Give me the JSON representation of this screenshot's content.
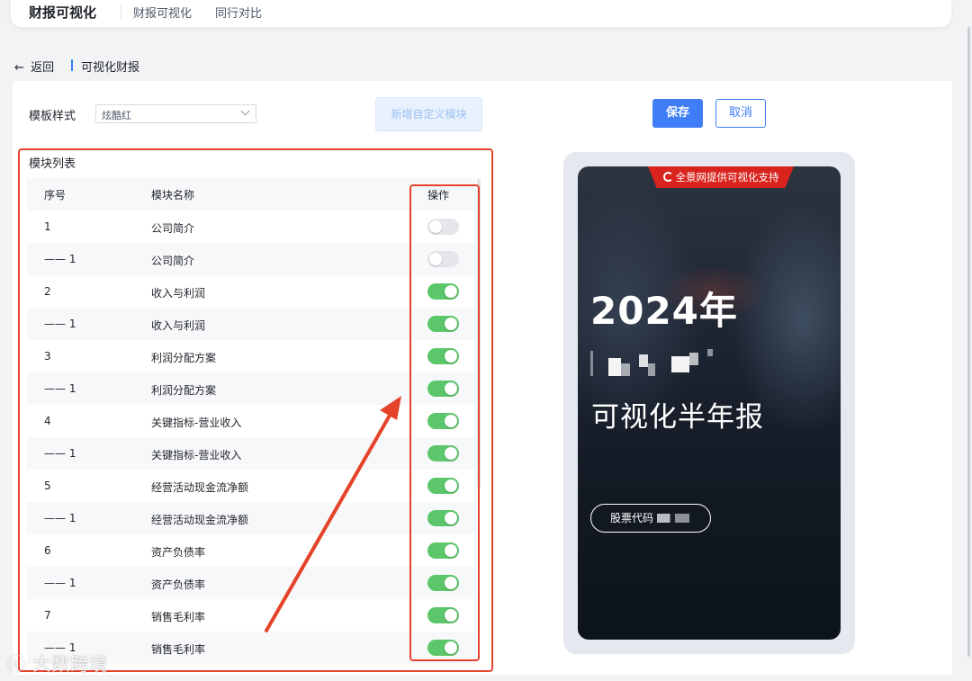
{
  "nav": {
    "brand": "财报可视化",
    "links": [
      "财报可视化",
      "同行对比"
    ]
  },
  "breadcrumb": {
    "back": "返回",
    "title": "可视化财报"
  },
  "form": {
    "template_label": "模板样式",
    "template_value": "炫酷红",
    "add_module": "新增自定义模块",
    "save": "保存",
    "cancel": "取消"
  },
  "module_list": {
    "title": "模块列表",
    "headers": {
      "index": "序号",
      "name": "模块名称",
      "action": "操作"
    },
    "rows": [
      {
        "index": "1",
        "name": "公司简介",
        "enabled": false
      },
      {
        "index": "—— 1",
        "name": "公司简介",
        "enabled": false
      },
      {
        "index": "2",
        "name": "收入与利润",
        "enabled": true
      },
      {
        "index": "—— 1",
        "name": "收入与利润",
        "enabled": true
      },
      {
        "index": "3",
        "name": "利润分配方案",
        "enabled": true
      },
      {
        "index": "—— 1",
        "name": "利润分配方案",
        "enabled": true
      },
      {
        "index": "4",
        "name": "关键指标-营业收入",
        "enabled": true
      },
      {
        "index": "—— 1",
        "name": "关键指标-营业收入",
        "enabled": true
      },
      {
        "index": "5",
        "name": "经营活动现金流净额",
        "enabled": true
      },
      {
        "index": "—— 1",
        "name": "经营活动现金流净额",
        "enabled": true
      },
      {
        "index": "6",
        "name": "资产负债率",
        "enabled": true
      },
      {
        "index": "—— 1",
        "name": "资产负债率",
        "enabled": true
      },
      {
        "index": "7",
        "name": "销售毛利率",
        "enabled": true
      },
      {
        "index": "—— 1",
        "name": "销售毛利率",
        "enabled": true
      }
    ]
  },
  "preview": {
    "ribbon": "全景网提供可视化支持",
    "year": "2024年",
    "subtitle": "可视化半年报",
    "stock_label": "股票代码"
  },
  "watermark": "大数跨境",
  "colors": {
    "accent": "#3f7ef6",
    "toggle_on": "#5cc66a",
    "annotation": "#e4432a",
    "ribbon": "#d9231d"
  }
}
